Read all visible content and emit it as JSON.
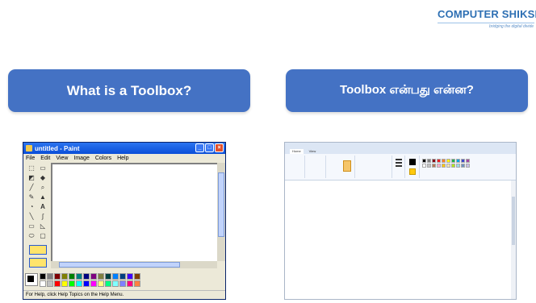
{
  "logo": {
    "text": "COMPUTER SHIKSHA",
    "tagline": "bridging the digital divide"
  },
  "left_heading": "What is a Toolbox?",
  "right_heading": "Toolbox என்பது என்ன?",
  "xp_paint": {
    "title": "untitled - Paint",
    "menu": [
      "File",
      "Edit",
      "View",
      "Image",
      "Colors",
      "Help"
    ],
    "status": "For Help, click Help Topics on the Help Menu.",
    "colors": {
      "titlebar": "#0b4ed8",
      "palette": [
        "#000000",
        "#808080",
        "#800000",
        "#808000",
        "#008000",
        "#008080",
        "#000080",
        "#800080",
        "#808040",
        "#004040",
        "#0080ff",
        "#004080",
        "#4000ff",
        "#804000",
        "#ffffff",
        "#c0c0c0",
        "#ff0000",
        "#ffff00",
        "#00ff00",
        "#00ffff",
        "#0000ff",
        "#ff00ff",
        "#ffff80",
        "#00ff80",
        "#80ffff",
        "#8080ff",
        "#ff0080",
        "#ff8040"
      ]
    }
  },
  "win7_paint": {
    "tabs": [
      "Home",
      "View"
    ],
    "palette": [
      "#000000",
      "#7f7f7f",
      "#880015",
      "#ed1c24",
      "#ff7f27",
      "#fff200",
      "#22b14c",
      "#00a2e8",
      "#3f48cc",
      "#a349a4",
      "#ffffff",
      "#c3c3c3",
      "#b97a57",
      "#ffaec9",
      "#ffc90e",
      "#efe4b0",
      "#b5e61d",
      "#99d9ea",
      "#7092be",
      "#c8bfe7"
    ]
  }
}
